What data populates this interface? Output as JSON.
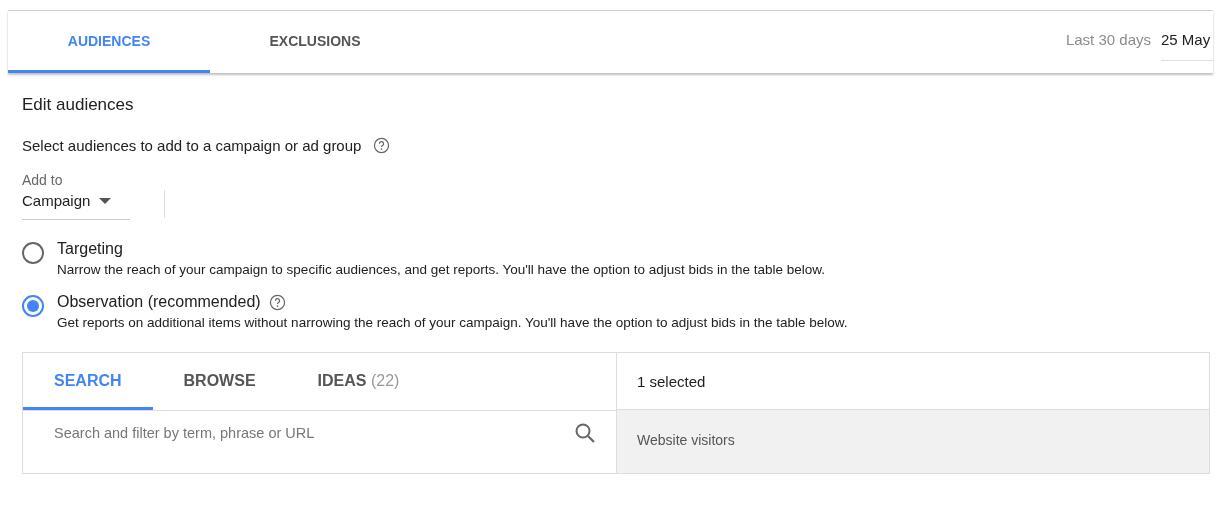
{
  "tabs": [
    {
      "label": "AUDIENCES",
      "selected": true
    },
    {
      "label": "EXCLUSIONS",
      "selected": false
    }
  ],
  "date_range": {
    "label": "Last 30 days",
    "value": "25 May"
  },
  "heading": "Edit audiences",
  "instruction": "Select audiences to add to a campaign or ad group",
  "add_to": {
    "label": "Add to",
    "value": "Campaign"
  },
  "options": [
    {
      "title": "Targeting",
      "description": "Narrow the reach of your campaign to specific audiences, and get reports. You'll have the option to adjust bids in the table below.",
      "selected": false,
      "help": false
    },
    {
      "title": "Observation (recommended)",
      "description": "Get reports on additional items without narrowing the reach of your campaign. You'll have the option to adjust bids in the table below.",
      "selected": true,
      "help": true
    }
  ],
  "picker_tabs": [
    {
      "label": "SEARCH",
      "selected": true
    },
    {
      "label": "BROWSE",
      "selected": false
    },
    {
      "label": "IDEAS",
      "count": "(22)",
      "selected": false
    }
  ],
  "search": {
    "placeholder": "Search and filter by term, phrase or URL"
  },
  "selected_summary": "1 selected",
  "selected_items": [
    "Website visitors"
  ]
}
